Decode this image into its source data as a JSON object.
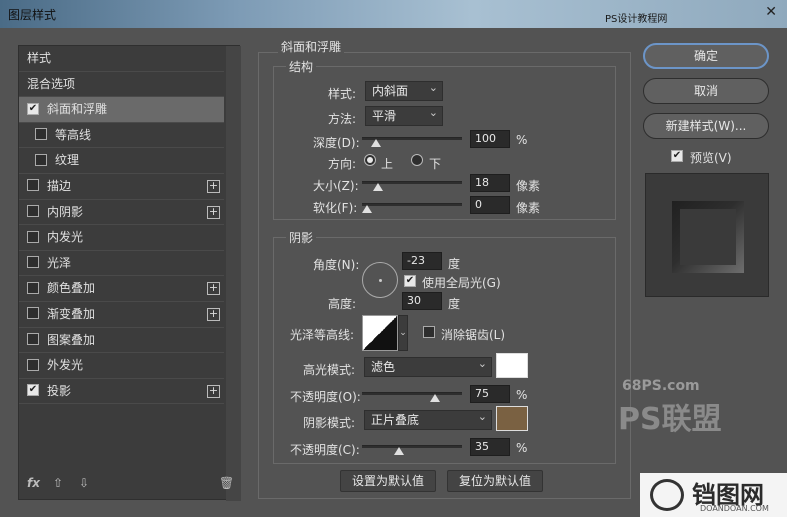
{
  "window": {
    "title": "图层样式",
    "site_tag": "PS设计教程网",
    "close": "✕"
  },
  "sidebar": {
    "items": [
      {
        "label": "样式",
        "checkbox": false,
        "checked": false,
        "plus": false,
        "sub": false,
        "selected": false
      },
      {
        "label": "混合选项",
        "checkbox": false,
        "checked": false,
        "plus": false,
        "sub": false,
        "selected": false
      },
      {
        "label": "斜面和浮雕",
        "checkbox": true,
        "checked": true,
        "plus": false,
        "sub": false,
        "selected": true
      },
      {
        "label": "等高线",
        "checkbox": true,
        "checked": false,
        "plus": false,
        "sub": true,
        "selected": false
      },
      {
        "label": "纹理",
        "checkbox": true,
        "checked": false,
        "plus": false,
        "sub": true,
        "selected": false
      },
      {
        "label": "描边",
        "checkbox": true,
        "checked": false,
        "plus": true,
        "sub": false,
        "selected": false
      },
      {
        "label": "内阴影",
        "checkbox": true,
        "checked": false,
        "plus": true,
        "sub": false,
        "selected": false
      },
      {
        "label": "内发光",
        "checkbox": true,
        "checked": false,
        "plus": false,
        "sub": false,
        "selected": false
      },
      {
        "label": "光泽",
        "checkbox": true,
        "checked": false,
        "plus": false,
        "sub": false,
        "selected": false
      },
      {
        "label": "颜色叠加",
        "checkbox": true,
        "checked": false,
        "plus": true,
        "sub": false,
        "selected": false
      },
      {
        "label": "渐变叠加",
        "checkbox": true,
        "checked": false,
        "plus": true,
        "sub": false,
        "selected": false
      },
      {
        "label": "图案叠加",
        "checkbox": true,
        "checked": false,
        "plus": false,
        "sub": false,
        "selected": false
      },
      {
        "label": "外发光",
        "checkbox": true,
        "checked": false,
        "plus": false,
        "sub": false,
        "selected": false
      },
      {
        "label": "投影",
        "checkbox": true,
        "checked": true,
        "plus": true,
        "sub": false,
        "selected": false
      }
    ],
    "footer": {
      "fx": "fx",
      "up": "⇧",
      "down": "⇩",
      "trash": "🗑"
    }
  },
  "bevel": {
    "section_title": "斜面和浮雕",
    "structure_title": "结构",
    "style_label": "样式:",
    "style_value": "内斜面",
    "technique_label": "方法:",
    "technique_value": "平滑",
    "depth_label": "深度(D):",
    "depth_value": "100",
    "depth_unit": "%",
    "depth_level": 0.1,
    "direction_label": "方向:",
    "direction_up": "上",
    "direction_down": "下",
    "direction_selected": "up",
    "size_label": "大小(Z):",
    "size_value": "18",
    "size_unit": "像素",
    "size_level": 0.12,
    "soften_label": "软化(F):",
    "soften_value": "0",
    "soften_unit": "像素",
    "soften_level": 0.0,
    "shading_title": "阴影",
    "angle_label": "角度(N):",
    "angle_value": "-23",
    "angle_unit": "度",
    "global_light_label": "使用全局光(G)",
    "global_light_checked": true,
    "altitude_label": "高度:",
    "altitude_value": "30",
    "altitude_unit": "度",
    "gloss_label": "光泽等高线:",
    "antialias_label": "消除锯齿(L)",
    "antialias_checked": false,
    "highlight_mode_label": "高光模式:",
    "highlight_mode_value": "滤色",
    "highlight_color": "#ffffff",
    "highlight_opacity_label": "不透明度(O):",
    "highlight_opacity_value": "75",
    "highlight_opacity_unit": "%",
    "highlight_opacity_level": 0.75,
    "shadow_mode_label": "阴影模式:",
    "shadow_mode_value": "正片叠底",
    "shadow_color": "#7a6142",
    "shadow_opacity_label": "不透明度(C):",
    "shadow_opacity_value": "35",
    "shadow_opacity_unit": "%",
    "shadow_opacity_level": 0.35,
    "make_default": "设置为默认值",
    "reset_default": "复位为默认值"
  },
  "actions": {
    "ok": "确定",
    "cancel": "取消",
    "new_style": "新建样式(W)...",
    "preview_label": "预览(V)",
    "preview_checked": true
  },
  "watermarks": {
    "site1": "68PS.com",
    "site2": "PS联盟",
    "logo_text": "铛图网",
    "logo_sub": "DOANDOAN.COM"
  }
}
